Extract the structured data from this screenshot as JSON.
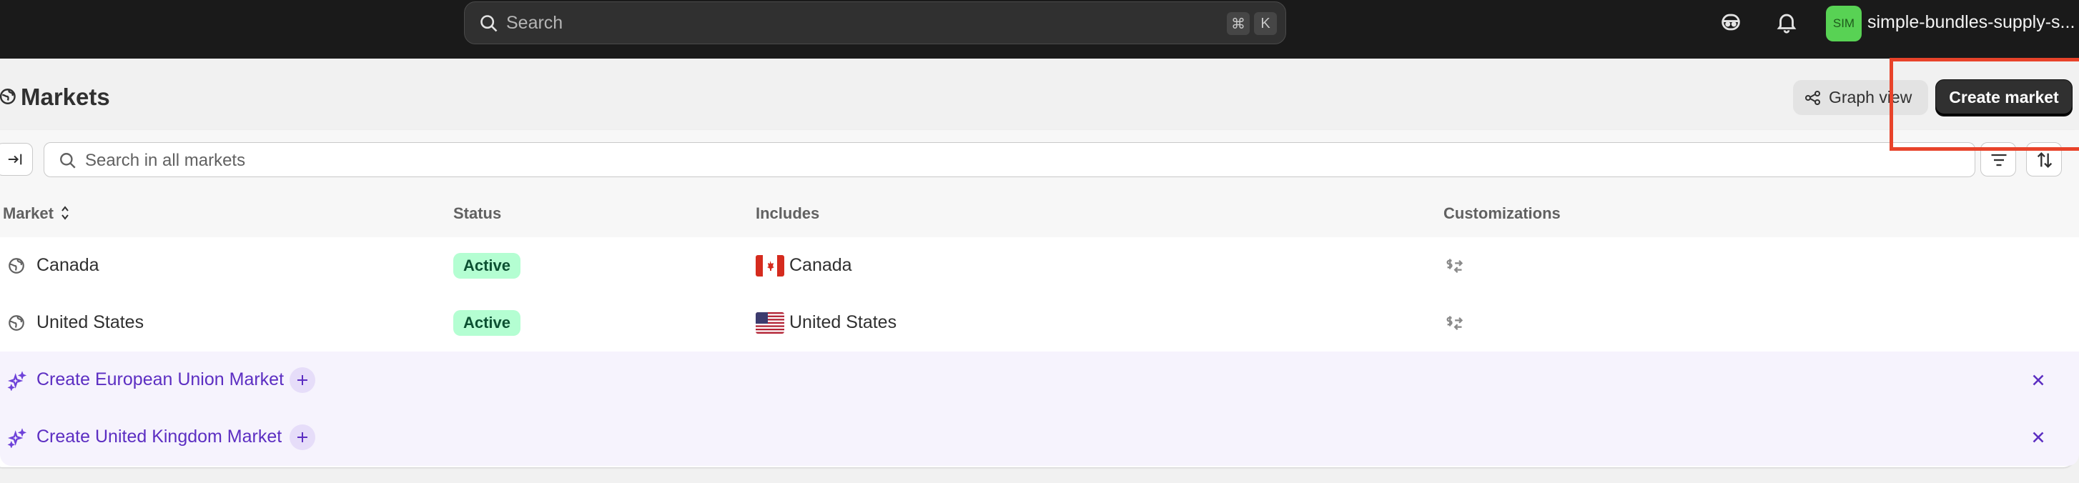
{
  "topbar": {
    "search_placeholder": "Search",
    "shortcut_keys": [
      "⌘",
      "K"
    ],
    "avatar_initials": "SIM",
    "store_name": "simple-bundles-supply-s..."
  },
  "header": {
    "title": "Markets",
    "graph_view_label": "Graph view",
    "create_market_label": "Create market"
  },
  "filter": {
    "placeholder": "Search in all markets"
  },
  "table": {
    "columns": {
      "market": "Market",
      "status": "Status",
      "includes": "Includes",
      "customizations": "Customizations"
    },
    "rows": [
      {
        "market": "Canada",
        "status": "Active",
        "includes": "Canada",
        "flag": "canada-flag"
      },
      {
        "market": "United States",
        "status": "Active",
        "includes": "United States",
        "flag": "us-flag"
      }
    ],
    "suggestions": [
      {
        "label": "Create European Union Market"
      },
      {
        "label": "Create United Kingdom Market"
      }
    ]
  },
  "colors": {
    "topbar_bg": "#1a1a1a",
    "primary_button": "#303030",
    "active_badge_bg": "#b4fed2",
    "suggestion_text": "#5c2ec2",
    "highlight_box": "#e8432a"
  }
}
